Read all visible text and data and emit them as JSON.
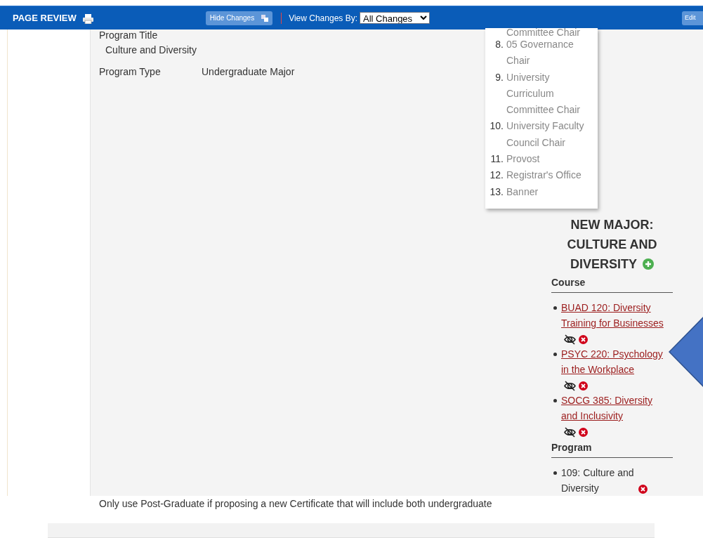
{
  "header": {
    "title": "PAGE REVIEW",
    "hide_changes_button": "Hide Changes",
    "view_label": "View Changes By:",
    "view_select": "All Changes",
    "edit_button": "Edit"
  },
  "fields": [
    {
      "label": "Program Title",
      "value": "Culture and Diversity",
      "kind": "stacked"
    },
    {
      "label": "Program Type",
      "value": "Undergraduate Major",
      "kind": "inline"
    }
  ],
  "workflow": {
    "cut_text": "Committee Chair",
    "steps": [
      {
        "number": "8.",
        "name": "05 Governance Chair"
      },
      {
        "number": "9.",
        "name": "University Curriculum Committee Chair"
      },
      {
        "number": "10.",
        "name": "University Faculty Council Chair"
      },
      {
        "number": "11.",
        "name": "Provost"
      },
      {
        "number": "12.",
        "name": "Registrar's Office"
      },
      {
        "number": "13.",
        "name": "Banner"
      }
    ]
  },
  "relationships": {
    "title": "NEW MAJOR: CULTURE AND DIVERSITY",
    "sections": [
      {
        "heading": "Course",
        "items": [
          {
            "text": "BUAD 120: Diversity Training for Businesses",
            "linked": true,
            "hide_toggle": true
          },
          {
            "text": "PSYC 220: Psychology in the Workplace",
            "linked": true,
            "hide_toggle": true
          },
          {
            "text": "SOCG 385: Diversity and Inclusivity",
            "linked": true,
            "hide_toggle": true
          }
        ]
      },
      {
        "heading": "Program",
        "items": [
          {
            "text": "109: Culture and Diversity",
            "linked": false,
            "hide_toggle": false
          }
        ]
      }
    ]
  },
  "note": "Only use Post-Graduate if proposing a new Certificate that will include both undergraduate"
}
